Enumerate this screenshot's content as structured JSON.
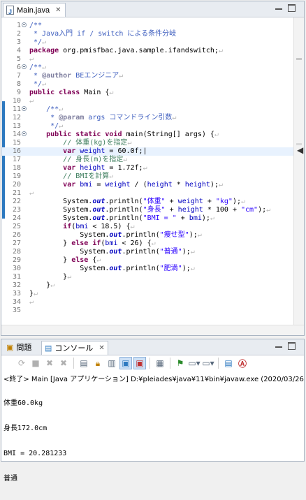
{
  "editor": {
    "tab_title": "Main.java",
    "lines": [
      {
        "n": "1",
        "fold": true,
        "html": "<span class=\"jd\">/**</span>"
      },
      {
        "n": "2",
        "html": "<span class=\"jd\"> * Java入門 if / switch による条件分岐</span>"
      },
      {
        "n": "3",
        "html": "<span class=\"jd\"> */</span><span class=\"ws\">↵</span>"
      },
      {
        "n": "4",
        "html": "<span class=\"kw\">package</span> org.pmisfbac.java.sample.ifandswitch;<span class=\"ws\">↵</span>"
      },
      {
        "n": "5",
        "html": "<span class=\"ws\">↵</span>"
      },
      {
        "n": "6",
        "fold": true,
        "html": "<span class=\"jd\">/**</span><span class=\"ws\">↵</span>"
      },
      {
        "n": "7",
        "html": "<span class=\"jd\"> * </span><span class=\"tag\">@author</span><span class=\"jd\"> BEエンジニア</span><span class=\"ws\">↵</span>"
      },
      {
        "n": "8",
        "html": "<span class=\"jd\"> */</span><span class=\"ws\">↵</span>"
      },
      {
        "n": "9",
        "html": "<span class=\"kw\">public class</span> Main {<span class=\"ws\">↵</span>"
      },
      {
        "n": "10",
        "html": "<span class=\"ws\">↵</span>"
      },
      {
        "n": "11",
        "fold": true,
        "html": "    <span class=\"jd\">/**</span><span class=\"ws\">↵</span>"
      },
      {
        "n": "12",
        "html": "<span class=\"jd\">     * </span><span class=\"tag\">@param</span><span class=\"jd\"> args コマンドライン引数</span><span class=\"ws\">↵</span>"
      },
      {
        "n": "13",
        "html": "<span class=\"jd\">     */</span><span class=\"ws\">↵</span>"
      },
      {
        "n": "14",
        "fold": true,
        "html": "    <span class=\"kw\">public static void</span> main(String[] args) {<span class=\"ws\">↵</span>"
      },
      {
        "n": "15",
        "html": "        <span class=\"cm\">// 体重(kg)を指定</span><span class=\"ws\">↵</span>"
      },
      {
        "n": "16",
        "current": true,
        "html": "        <span class=\"kw\">var</span> <span class=\"fld\">weight</span> = 60.0f;|"
      },
      {
        "n": "17",
        "html": "        <span class=\"cm\">// 身長(m)を指定</span><span class=\"ws\">↵</span>"
      },
      {
        "n": "18",
        "html": "        <span class=\"kw\">var</span> <span class=\"fld\">height</span> = 1.72f;<span class=\"ws\">↵</span>"
      },
      {
        "n": "19",
        "html": "        <span class=\"cm\">// BMIを計算</span><span class=\"ws\">↵</span>"
      },
      {
        "n": "20",
        "html": "        <span class=\"kw\">var</span> <span class=\"fld\">bmi</span> = <span class=\"fld\">weight</span> / (<span class=\"fld\">height</span> * <span class=\"fld\">height</span>);<span class=\"ws\">↵</span>"
      },
      {
        "n": "21",
        "html": "<span class=\"ws\">↵</span>"
      },
      {
        "n": "22",
        "html": "        System.<span class=\"fldi\">out</span>.println(<span class=\"st\">\"体重\"</span> + <span class=\"fld\">weight</span> + <span class=\"st\">\"kg\"</span>);<span class=\"ws\">↵</span>"
      },
      {
        "n": "23",
        "html": "        System.<span class=\"fldi\">out</span>.println(<span class=\"st\">\"身長\"</span> + <span class=\"fld\">height</span> * 100 + <span class=\"st\">\"cm\"</span>);<span class=\"ws\">↵</span>"
      },
      {
        "n": "24",
        "html": "        System.<span class=\"fldi\">out</span>.println(<span class=\"st\">\"BMI = \"</span> + <span class=\"fld\">bmi</span>);<span class=\"ws\">↵</span>"
      },
      {
        "n": "25",
        "html": "        <span class=\"kw\">if</span>(<span class=\"fld\">bmi</span> &lt; 18.5) {<span class=\"ws\">↵</span>"
      },
      {
        "n": "26",
        "html": "            System.<span class=\"fldi\">out</span>.println(<span class=\"st\">\"痩せ型\"</span>);<span class=\"ws\">↵</span>"
      },
      {
        "n": "27",
        "html": "        } <span class=\"kw\">else if</span>(<span class=\"fld\">bmi</span> &lt; 26) {<span class=\"ws\">↵</span>"
      },
      {
        "n": "28",
        "html": "            System.<span class=\"fldi\">out</span>.println(<span class=\"st\">\"普通\"</span>);<span class=\"ws\">↵</span>"
      },
      {
        "n": "29",
        "html": "        } <span class=\"kw\">else</span> {<span class=\"ws\">↵</span>"
      },
      {
        "n": "30",
        "html": "            System.<span class=\"fldi\">out</span>.println(<span class=\"st\">\"肥満\"</span>);<span class=\"ws\">↵</span>"
      },
      {
        "n": "31",
        "html": "        }<span class=\"ws\">↵</span>"
      },
      {
        "n": "32",
        "html": "    }<span class=\"ws\">↵</span>"
      },
      {
        "n": "33",
        "html": "}<span class=\"ws\">↵</span>"
      },
      {
        "n": "34",
        "html": "<span class=\"ws\">↵</span>"
      },
      {
        "n": "35",
        "html": ""
      }
    ]
  },
  "console": {
    "tabs": [
      {
        "label": "問題",
        "icon": "problems-icon",
        "active": false
      },
      {
        "label": "コンソール",
        "icon": "console-icon",
        "active": true
      }
    ],
    "status": "<終了> Main [Java アプリケーション] D:¥pleiades¥java¥11¥bin¥javaw.exe  (2020/03/26",
    "output": [
      "体重60.0kg",
      "身長172.0cm",
      "BMI = 20.281233",
      "普通"
    ]
  },
  "colors": {
    "accent": "#2d79c0",
    "keyword": "#7f0055",
    "string": "#2a00ff",
    "comment": "#3f7f5f"
  }
}
